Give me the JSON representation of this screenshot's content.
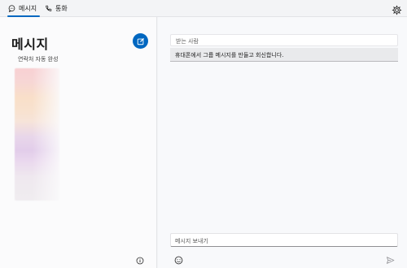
{
  "tabs": [
    {
      "label": "메시지",
      "icon": "chat-bubble-icon",
      "selected": true
    },
    {
      "label": "통화",
      "icon": "phone-icon",
      "selected": false
    }
  ],
  "settings": {
    "icon": "gear-icon"
  },
  "left_pane": {
    "title": "메시지",
    "compose_icon": "compose-icon",
    "autocomplete_label": "연락처 자동 완성",
    "info_icon": "info-icon"
  },
  "right_pane": {
    "recipient_placeholder": "받는 사람",
    "group_banner": "휴대폰에서 그룹 메시지를 만들고 회신합니다.",
    "compose_placeholder": "메시지 보내기",
    "emoji_icon": "emoji-icon",
    "send_icon": "send-icon"
  },
  "colors": {
    "accent": "#0067c0",
    "background": "#f3f4f6",
    "pane": "#fbfbfc"
  }
}
